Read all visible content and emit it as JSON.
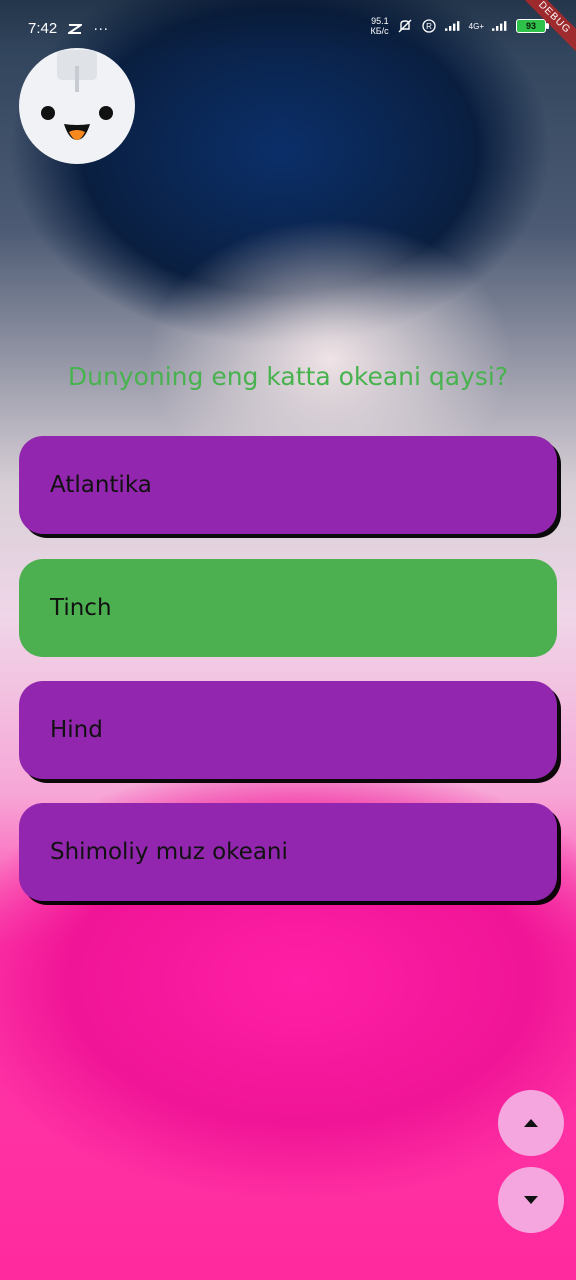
{
  "status_bar": {
    "time": "7:42",
    "more": "···",
    "net_speed_value": "95.1",
    "net_speed_unit": "КБ/с",
    "network_type": "4G+",
    "battery_level": "93"
  },
  "debug_banner": "DEBUG",
  "quiz": {
    "question": "Dunyoning eng katta okeani qaysi?",
    "answers": [
      {
        "label": "Atlantika",
        "state": "default"
      },
      {
        "label": "Tinch",
        "state": "correct"
      },
      {
        "label": "Hind",
        "state": "default"
      },
      {
        "label": "Shimoliy muz okeani",
        "state": "default"
      }
    ]
  },
  "colors": {
    "question": "#48b24f",
    "answer_default": "#9226ae",
    "answer_correct": "#4cb050",
    "fab_background": "#f6a6de"
  },
  "icons": {
    "scroll_up": "triangle-up-icon",
    "scroll_down": "triangle-down-icon",
    "avatar": "robot-face-icon"
  }
}
